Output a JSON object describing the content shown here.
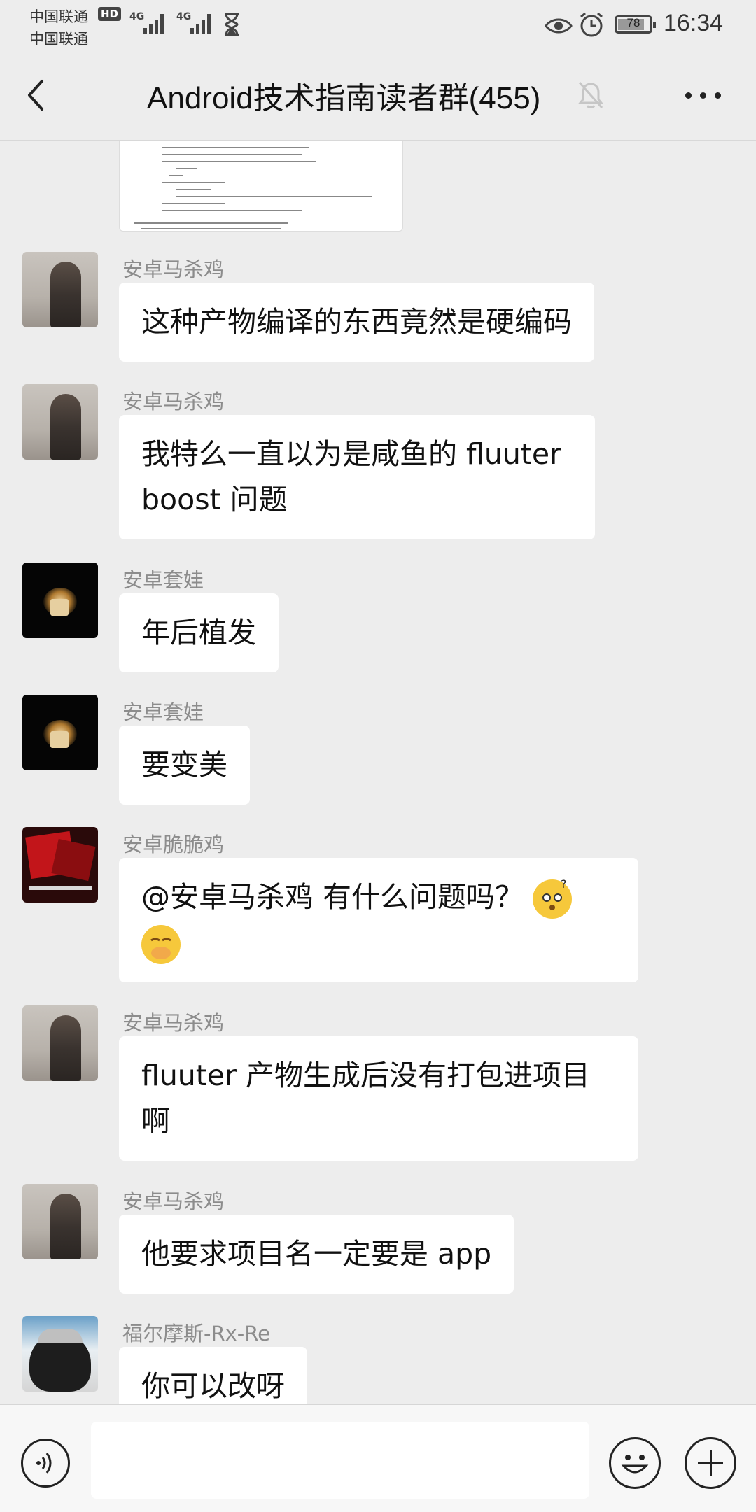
{
  "status_bar": {
    "carrier_1": "中国联通",
    "carrier_2": "中国联通",
    "hd": "HD",
    "network_1": "4G",
    "network_2": "4G",
    "battery": "78",
    "time": "16:34",
    "icons": [
      "hourglass-icon",
      "eye-icon",
      "alarm-icon",
      "battery-icon"
    ]
  },
  "header": {
    "title": "Android技术指南读者群(455)",
    "icons": [
      "back-arrow-icon",
      "muted-bell-icon",
      "more-icon"
    ]
  },
  "messages": [
    {
      "sender": "安卓马杀鸡",
      "text": "这种产物编译的东西竟然是硬编码",
      "avatar": "man"
    },
    {
      "sender": "安卓马杀鸡",
      "text": "我特么一直以为是咸鱼的 fluuter boost 问题",
      "avatar": "man"
    },
    {
      "sender": "安卓套娃",
      "text": "年后植发",
      "avatar": "candle"
    },
    {
      "sender": "安卓套娃",
      "text": "要变美",
      "avatar": "candle"
    },
    {
      "sender": "安卓脆脆鸡",
      "text": "@安卓马杀鸡  有什么问题吗？",
      "avatar": "red",
      "emojis": [
        "thinking-emoji-icon",
        "cover-mouth-emoji-icon"
      ]
    },
    {
      "sender": "安卓马杀鸡",
      "text": "fluuter 产物生成后没有打包进项目啊",
      "avatar": "man"
    },
    {
      "sender": "安卓马杀鸡",
      "text": "他要求项目名一定要是 app",
      "avatar": "man"
    },
    {
      "sender": "福尔摩斯-Rx-Re",
      "text": "你可以改呀",
      "avatar": "badger"
    }
  ],
  "input_bar": {
    "icons": [
      "voice-icon",
      "emoji-icon",
      "plus-icon"
    ],
    "text": ""
  }
}
